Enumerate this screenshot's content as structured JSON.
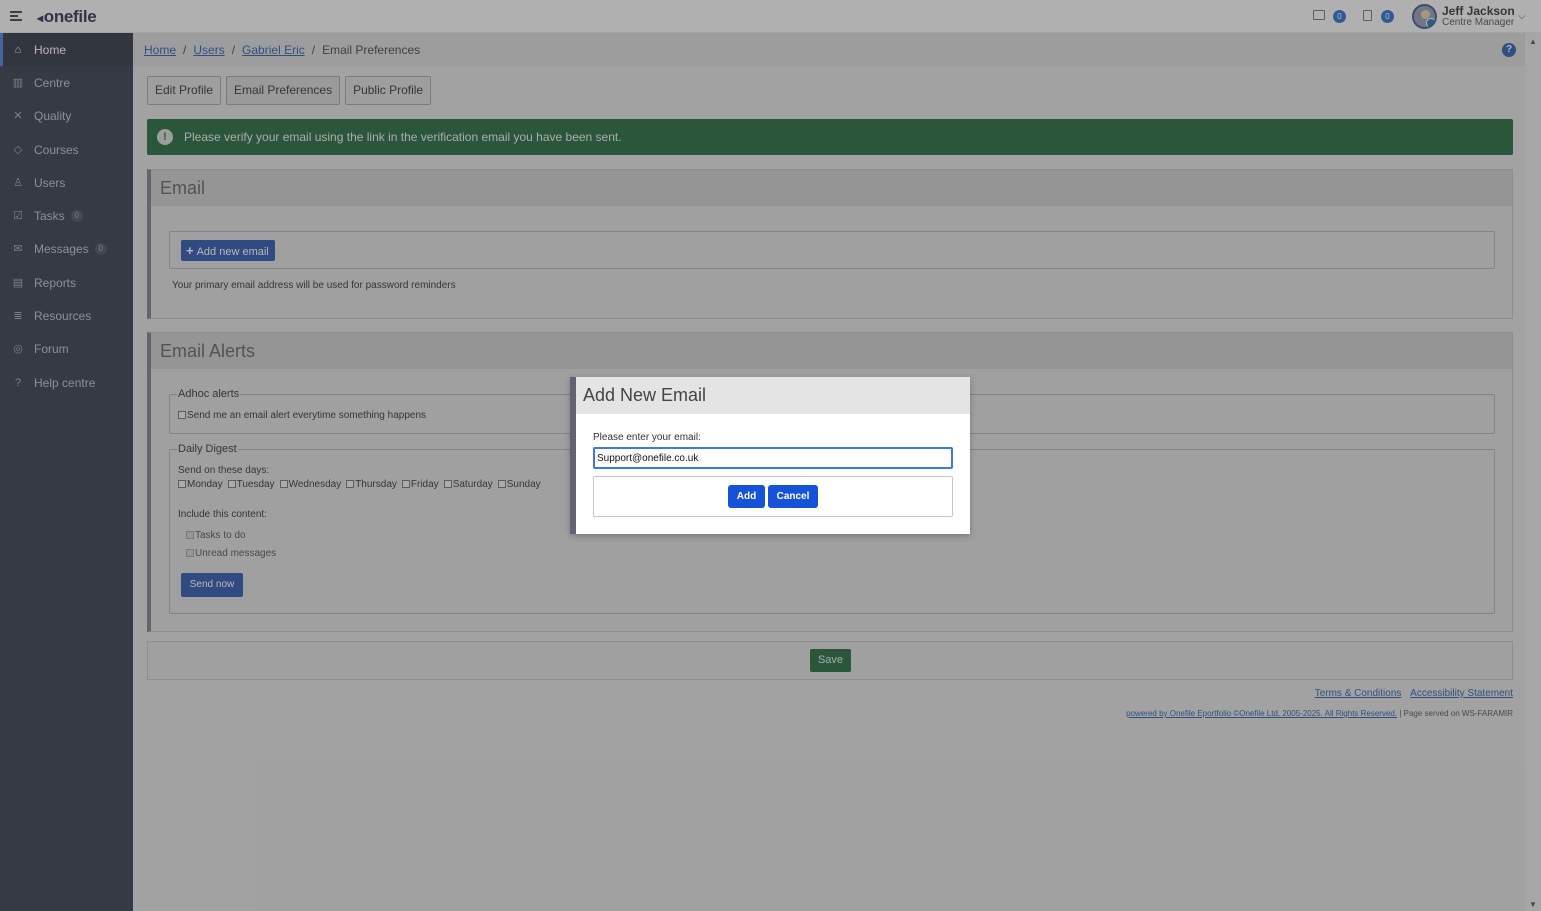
{
  "app": {
    "logo_text": "onefile"
  },
  "header": {
    "messages_count": "0",
    "tasks_count": "0",
    "user_name": "Jeff Jackson",
    "user_role": "Centre Manager"
  },
  "sidebar": {
    "items": [
      {
        "label": "Home",
        "icon": "home-icon"
      },
      {
        "label": "Centre",
        "icon": "building-icon"
      },
      {
        "label": "Quality",
        "icon": "tools-icon"
      },
      {
        "label": "Courses",
        "icon": "graduation-cap-icon"
      },
      {
        "label": "Users",
        "icon": "users-icon"
      },
      {
        "label": "Tasks",
        "icon": "clipboard-check-icon",
        "badge": "0"
      },
      {
        "label": "Messages",
        "icon": "envelope-icon",
        "badge": "0"
      },
      {
        "label": "Reports",
        "icon": "report-icon"
      },
      {
        "label": "Resources",
        "icon": "book-stack-icon"
      },
      {
        "label": "Forum",
        "icon": "chat-bubbles-icon"
      },
      {
        "label": "Help centre",
        "icon": "question-circle-icon"
      }
    ]
  },
  "breadcrumb": {
    "items": [
      "Home",
      "Users",
      "Gabriel Eric"
    ],
    "current": "Email Preferences",
    "separator": "/"
  },
  "tabs": [
    "Edit Profile",
    "Email Preferences",
    "Public Profile"
  ],
  "alert": {
    "text": "Please verify your email using the link in the verification email you have been sent."
  },
  "email_panel": {
    "title": "Email",
    "add_button": "Add new email",
    "note": "Your primary email address will be used for password reminders"
  },
  "alerts_panel": {
    "title": "Email Alerts",
    "adhoc_legend": "Adhoc alerts",
    "adhoc_option": "Send me an email alert everytime something happens",
    "digest_legend": "Daily Digest",
    "days_label": "Send on these days:",
    "days": [
      "Monday",
      "Tuesday",
      "Wednesday",
      "Thursday",
      "Friday",
      "Saturday",
      "Sunday"
    ],
    "content_label": "Include this content:",
    "content_options": [
      "Tasks to do",
      "Unread messages"
    ],
    "send_now": "Send now"
  },
  "save_button": "Save",
  "footer": {
    "terms": "Terms & Conditions",
    "accessibility": "Accessibility Statement",
    "powered": "powered by Onefile Eportfolio ©Onefile Ltd, 2005-2025. All Rights Reserved.",
    "served": "| Page served on WS-FARAMIR"
  },
  "modal": {
    "title": "Add New Email",
    "label": "Please enter your email:",
    "value": "Support@onefile.co.uk",
    "add": "Add",
    "cancel": "Cancel"
  },
  "colors": {
    "sidebar_bg": "#222a3b",
    "alert_green": "#0f5a2d",
    "button_blue": "#1747a6",
    "modal_button_blue": "#1552d8",
    "link_blue": "#1a4fa0"
  }
}
